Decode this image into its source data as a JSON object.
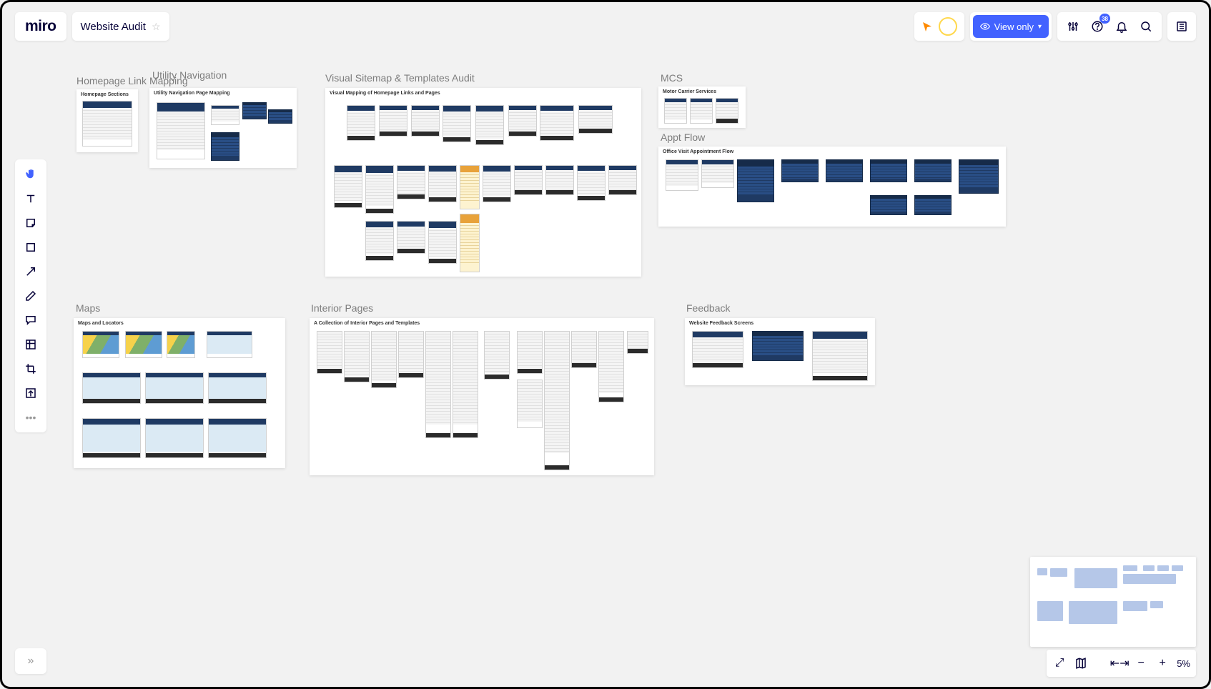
{
  "app": {
    "logo": "miro",
    "board_title": "Website Audit"
  },
  "view_button": {
    "label": "View only"
  },
  "notifications": {
    "badge": "38"
  },
  "zoom": {
    "level": "5%"
  },
  "frames": {
    "homepage": {
      "title": "Homepage Link Mapping",
      "inner": "Homepage Sections"
    },
    "utility": {
      "title": "Utility Navigation",
      "inner": "Utility Navigation Page Mapping"
    },
    "sitemap": {
      "title": "Visual Sitemap & Templates Audit",
      "inner": "Visual Mapping of Homepage Links and Pages"
    },
    "mcs": {
      "title": "MCS",
      "inner": "Motor Carrier Services"
    },
    "appt": {
      "title": "Appt Flow",
      "inner": "Office Visit Appointment Flow"
    },
    "maps": {
      "title": "Maps",
      "inner": "Maps and Locators"
    },
    "interior": {
      "title": "Interior Pages",
      "inner": "A Collection of Interior Pages and Templates"
    },
    "feedback": {
      "title": "Feedback",
      "inner": "Website Feedback Screens"
    }
  }
}
